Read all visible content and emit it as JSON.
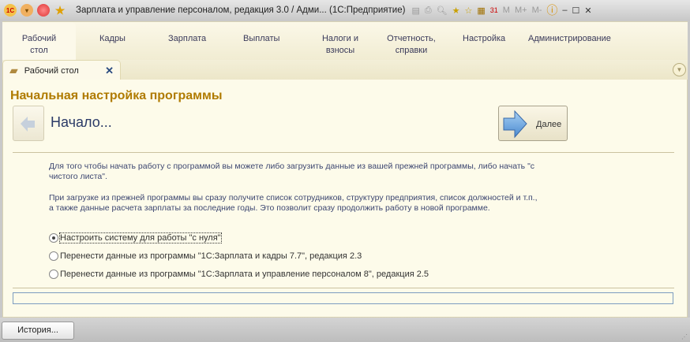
{
  "window": {
    "title": "Зарплата и управление персоналом, редакция 3.0 / Адми...  (1С:Предприятие)",
    "logo": "1С",
    "memory_buttons": [
      "M",
      "M+",
      "M-"
    ],
    "calendar_day": "31"
  },
  "sections": [
    {
      "label": "Рабочий стол"
    },
    {
      "label": "Кадры"
    },
    {
      "label": "Зарплата"
    },
    {
      "label": "Выплаты"
    },
    {
      "label": "Налоги и взносы"
    },
    {
      "label": "Отчетность, справки"
    },
    {
      "label": "Настройка"
    },
    {
      "label": "Администрирование"
    }
  ],
  "tab": {
    "label": "Рабочий стол",
    "close": "✕"
  },
  "form": {
    "title": "Начальная настройка программы",
    "step": "Начало...",
    "next_label": "Далее",
    "paragraph1": "Для того чтобы начать работу с программой вы можете либо загрузить данные из вашей прежней программы, либо начать \"с чистого листа\".",
    "paragraph2": "При загрузке из прежней программы вы сразу получите список сотрудников, структуру предприятия, список должностей и т.п., а также данные расчета зарплаты за последние годы. Это позволит сразу продолжить работу в новой программе.",
    "options": [
      {
        "label": "Настроить систему для работы \"с нуля\"",
        "selected": true
      },
      {
        "label": "Перенести данные из программы \"1С:Зарплата и кадры 7.7\", редакция 2.3",
        "selected": false
      },
      {
        "label": "Перенести данные из программы \"1С:Зарплата и управление персоналом 8\", редакция 2.5",
        "selected": false
      }
    ],
    "progress": 0
  },
  "footer": {
    "history_label": "История..."
  },
  "colors": {
    "accent": "#b07b00",
    "link": "#2b3a67",
    "background": "#fdfbea"
  }
}
